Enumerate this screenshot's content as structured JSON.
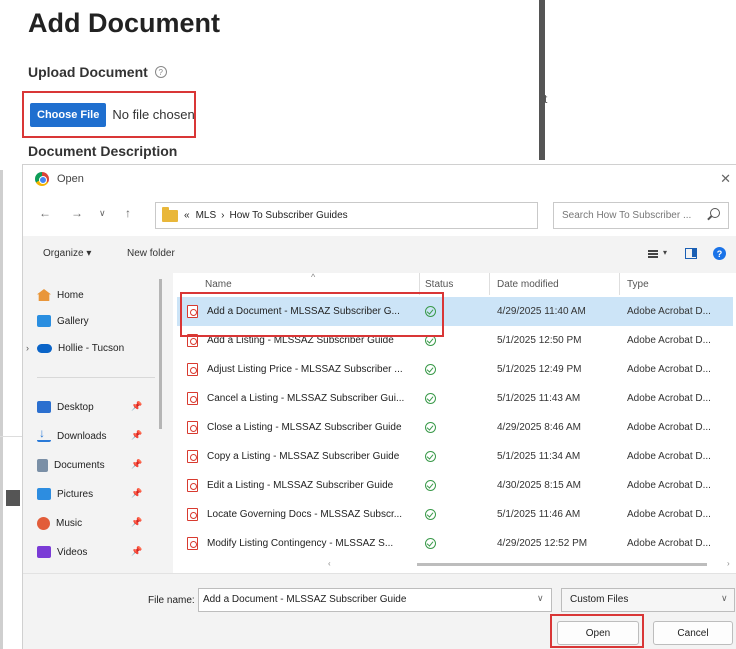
{
  "page": {
    "title": "Add Document",
    "upload_label": "Upload Document",
    "help_glyph": "?",
    "choose_file_label": "Choose File",
    "no_file_text": "No file chosen",
    "description_label": "Document Description",
    "side_char": "t"
  },
  "dialog": {
    "title": "Open",
    "close_glyph": "✕",
    "nav": {
      "back": "←",
      "forward": "→",
      "recent": "∨",
      "up": "↑"
    },
    "address": {
      "prefix": "«",
      "crumbs": [
        "MLS",
        "›",
        "How To Subscriber Guides"
      ],
      "dropdown": "∨",
      "refresh": "↻"
    },
    "search_placeholder": "Search How To Subscriber ...",
    "toolbar": {
      "organize": "Organize ▾",
      "new_folder": "New folder",
      "view_dropdown": "▾",
      "help_glyph": "?"
    },
    "nav_pane": {
      "expand_glyph": "›",
      "pin_glyph": "📌",
      "items": [
        {
          "label": "Home",
          "icon": "home-icon"
        },
        {
          "label": "Gallery",
          "icon": "gallery-icon"
        },
        {
          "label": "Hollie - Tucson",
          "icon": "cloud-icon"
        },
        {
          "label": "Desktop",
          "icon": "desktop-icon"
        },
        {
          "label": "Downloads",
          "icon": "downloads-icon"
        },
        {
          "label": "Documents",
          "icon": "documents-icon"
        },
        {
          "label": "Pictures",
          "icon": "pictures-icon"
        },
        {
          "label": "Music",
          "icon": "music-icon"
        },
        {
          "label": "Videos",
          "icon": "videos-icon"
        }
      ]
    },
    "columns": {
      "name": "Name",
      "status": "Status",
      "date": "Date modified",
      "type": "Type",
      "sort_caret": "^"
    },
    "files": [
      {
        "name": "Add a Document - MLSSAZ Subscriber G...",
        "date": "4/29/2025 11:40 AM",
        "type": "Adobe Acrobat D...",
        "selected": true
      },
      {
        "name": "Add a Listing - MLSSAZ Subscriber Guide",
        "date": "5/1/2025 12:50 PM",
        "type": "Adobe Acrobat D..."
      },
      {
        "name": "Adjust Listing Price - MLSSAZ Subscriber ...",
        "date": "5/1/2025 12:49 PM",
        "type": "Adobe Acrobat D..."
      },
      {
        "name": "Cancel a Listing - MLSSAZ Subscriber Gui...",
        "date": "5/1/2025 11:43 AM",
        "type": "Adobe Acrobat D..."
      },
      {
        "name": "Close a Listing - MLSSAZ Subscriber Guide",
        "date": "4/29/2025 8:46 AM",
        "type": "Adobe Acrobat D..."
      },
      {
        "name": "Copy a Listing - MLSSAZ Subscriber Guide",
        "date": "5/1/2025 11:34 AM",
        "type": "Adobe Acrobat D..."
      },
      {
        "name": "Edit a Listing - MLSSAZ Subscriber Guide",
        "date": "4/30/2025 8:15 AM",
        "type": "Adobe Acrobat D..."
      },
      {
        "name": "Locate Governing Docs - MLSSAZ Subscr...",
        "date": "5/1/2025 11:46 AM",
        "type": "Adobe Acrobat D..."
      },
      {
        "name": "Modify Listing Contingency - MLSSAZ S...",
        "date": "4/29/2025 12:52 PM",
        "type": "Adobe Acrobat D..."
      }
    ],
    "scroll": {
      "left": "‹",
      "right": "›"
    },
    "file_name_label": "File name:",
    "file_name_value": "Add a Document - MLSSAZ Subscriber Guide",
    "file_name_chevron": "∨",
    "file_type_filter": "Custom Files",
    "file_type_chevron": "∨",
    "open_button": "Open",
    "cancel_button": "Cancel"
  },
  "colors": {
    "highlight_red": "#d93636",
    "choose_button_blue": "#1f6fcf",
    "selected_row": "#cce4f7",
    "dialog_bg": "#f3f3f3"
  }
}
